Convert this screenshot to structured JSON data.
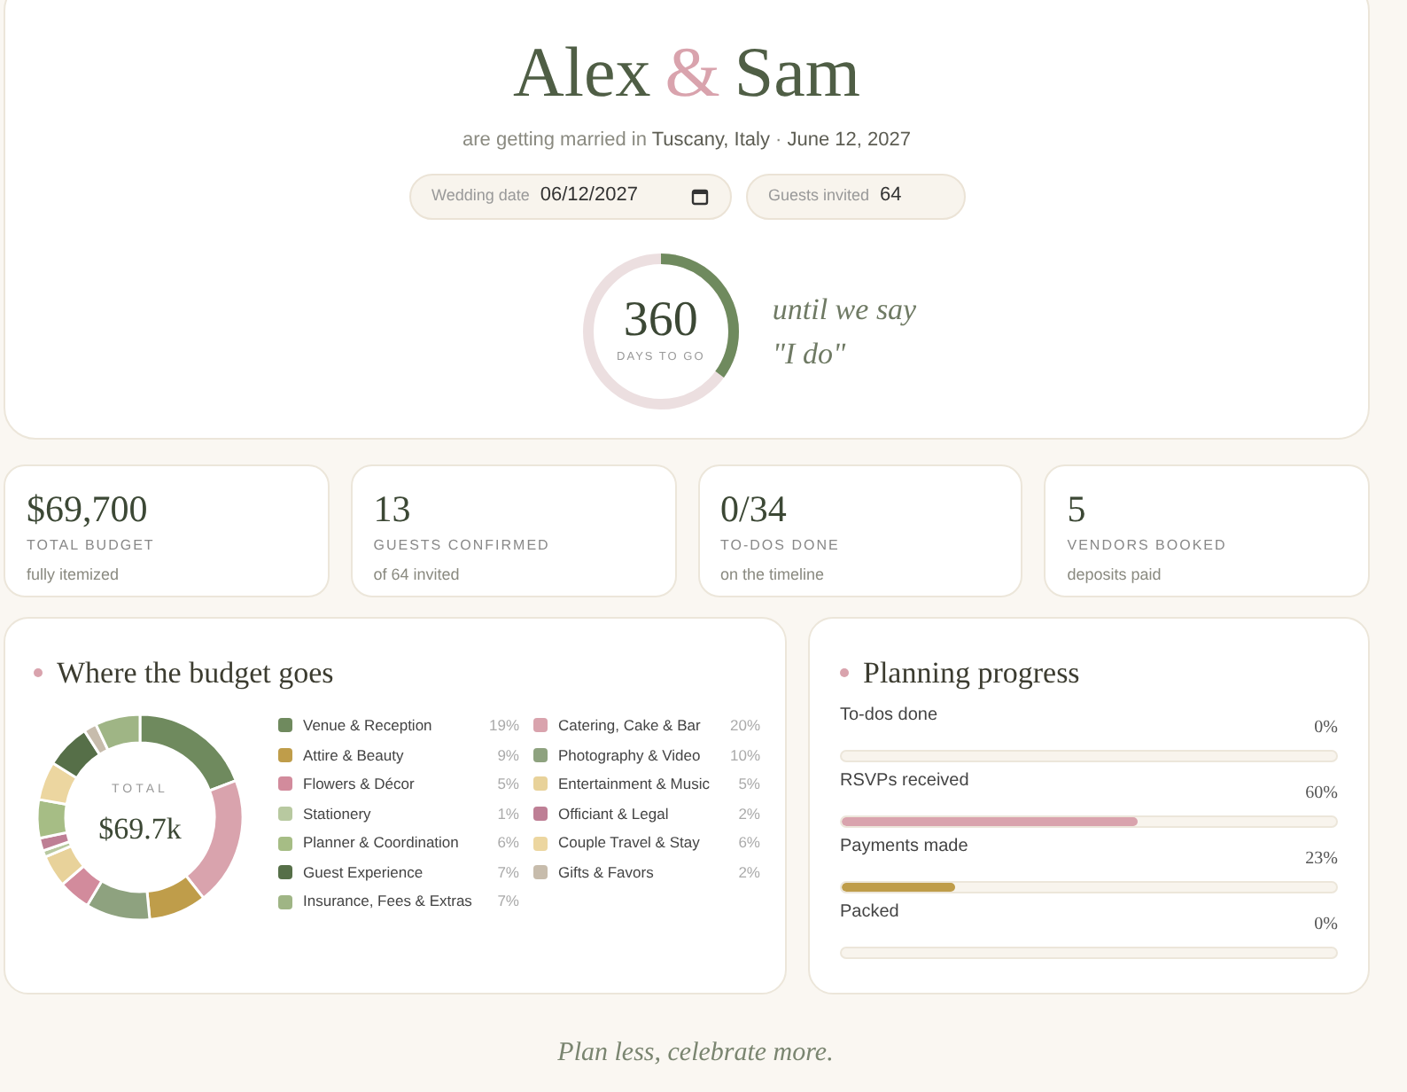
{
  "hero": {
    "name_1": "Alex",
    "ampersand": "&",
    "name_2": "Sam",
    "subtitle_prefix": "are getting married in",
    "place": "Tuscany, Italy",
    "separator": "·",
    "date": "June 12, 2027",
    "fields": [
      {
        "kind": "date",
        "label": "Wedding date",
        "value": "06/12/2027"
      },
      {
        "kind": "number",
        "label": "Guests invited",
        "value": "64"
      }
    ],
    "countdown": {
      "number": "360",
      "caption": "DAYS TO GO",
      "level": 0.35,
      "line_1": "until we say",
      "line_2": "\"I do\""
    }
  },
  "stats": [
    {
      "value": "$69,700",
      "label": "TOTAL BUDGET",
      "note": "fully itemized"
    },
    {
      "value": "13",
      "label": "GUESTS CONFIRMED",
      "note": "of 64 invited"
    },
    {
      "value": "0/34",
      "label": "TO-DOS DONE",
      "note": "on the timeline"
    },
    {
      "value": "5",
      "label": "VENDORS BOOKED",
      "note": "deposits paid"
    }
  ],
  "budget": {
    "title": "Where the budget goes",
    "total_label": "TOTAL",
    "total": "$69.7k",
    "legend": [
      {
        "label": "Venue & Reception",
        "percent": "19%",
        "color": "#6f8a5e"
      },
      {
        "label": "Catering, Cake & Bar",
        "percent": "20%",
        "color": "#d9a3ad"
      },
      {
        "label": "Attire & Beauty",
        "percent": "9%",
        "color": "#bf9d4a"
      },
      {
        "label": "Photography & Video",
        "percent": "10%",
        "color": "#8ea27f"
      },
      {
        "label": "Flowers & Décor",
        "percent": "5%",
        "color": "#d28b9c"
      },
      {
        "label": "Entertainment & Music",
        "percent": "5%",
        "color": "#e8d29a"
      },
      {
        "label": "Stationery",
        "percent": "1%",
        "color": "#b8c9a0"
      },
      {
        "label": "Officiant & Legal",
        "percent": "2%",
        "color": "#be7f95"
      },
      {
        "label": "Planner & Coordination",
        "percent": "6%",
        "color": "#a6bd85"
      },
      {
        "label": "Couple Travel & Stay",
        "percent": "6%",
        "color": "#ecd6a0"
      },
      {
        "label": "Guest Experience",
        "percent": "7%",
        "color": "#566f48"
      },
      {
        "label": "Gifts & Favors",
        "percent": "2%",
        "color": "#c7bcac"
      },
      {
        "label": "Insurance, Fees & Extras",
        "percent": "7%",
        "color": "#9fb585"
      }
    ],
    "chart_data": {
      "type": "donut",
      "values": [
        19,
        20,
        9,
        10,
        5,
        5,
        1,
        2,
        6,
        6,
        7,
        2,
        7
      ]
    }
  },
  "progress": {
    "title": "Planning progress",
    "items": [
      {
        "label": "To-dos done",
        "percent": "0%"
      },
      {
        "label": "RSVPs received",
        "percent": "60%",
        "level": 0.6,
        "color": "#d9a3ad"
      },
      {
        "label": "Payments made",
        "percent": "23%",
        "level": 0.23,
        "color": "#bf9d4a"
      },
      {
        "label": "Packed",
        "percent": "0%"
      }
    ]
  },
  "footer": "Plan less, celebrate more."
}
